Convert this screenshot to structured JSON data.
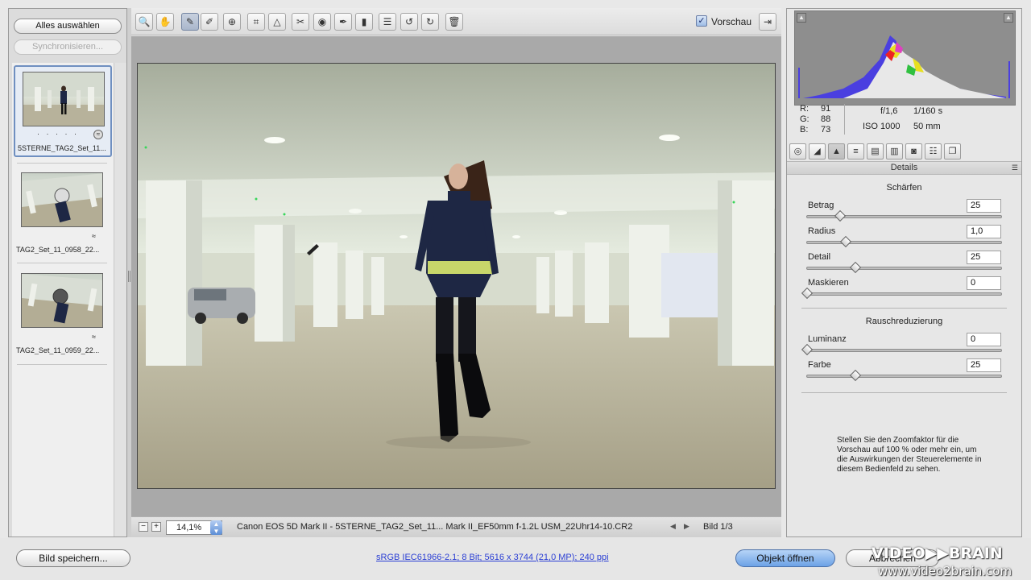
{
  "left_panel": {
    "select_all_label": "Alles auswählen",
    "sync_label": "Synchronisieren...",
    "thumbnails": [
      {
        "caption": "5STERNE_TAG2_Set_11...",
        "rating": "· · · · ·",
        "selected": true
      },
      {
        "caption": "TAG2_Set_11_0958_22...",
        "selected": false
      },
      {
        "caption": "TAG2_Set_11_0959_22...",
        "selected": false
      }
    ]
  },
  "toolbar": {
    "tools": [
      {
        "name": "zoom-tool-icon",
        "glyph": "🔍"
      },
      {
        "name": "hand-tool-icon",
        "glyph": "✋"
      },
      {
        "name": "white-balance-tool-icon",
        "glyph": "✎"
      },
      {
        "name": "color-sampler-tool-icon",
        "glyph": "✐"
      },
      {
        "name": "targeted-adjustment-tool-icon",
        "glyph": "⊕"
      },
      {
        "name": "crop-tool-icon",
        "glyph": "⌗"
      },
      {
        "name": "straighten-tool-icon",
        "glyph": "△"
      },
      {
        "name": "spot-removal-tool-icon",
        "glyph": "✂"
      },
      {
        "name": "red-eye-tool-icon",
        "glyph": "◉"
      },
      {
        "name": "adjustment-brush-icon",
        "glyph": "✒"
      },
      {
        "name": "graduated-filter-icon",
        "glyph": "▮"
      },
      {
        "name": "preferences-icon",
        "glyph": "☰"
      },
      {
        "name": "rotate-left-icon",
        "glyph": "↺"
      },
      {
        "name": "rotate-right-icon",
        "glyph": "↻"
      },
      {
        "name": "trash-icon",
        "glyph": "🗑"
      }
    ],
    "preview_label": "Vorschau",
    "preview_checked": true,
    "fullscreen_glyph": "⇥"
  },
  "status": {
    "zoom_value": "14,1%",
    "file_info": "Canon EOS 5D Mark II - 5STERNE_TAG2_Set_11... Mark II_EF50mm f-1.2L USM_22Uhr14-10.CR2",
    "image_counter": "Bild 1/3"
  },
  "readouts": {
    "r_label": "R:",
    "r_value": "91",
    "g_label": "G:",
    "g_value": "88",
    "b_label": "B:",
    "b_value": "73",
    "aperture": "f/1,6",
    "shutter": "1/160 s",
    "iso": "ISO 1000",
    "focal": "50 mm"
  },
  "panel": {
    "tabs": [
      "◎",
      "◢",
      "▲",
      "≡",
      "▤",
      "▥",
      "◙",
      "☷",
      "❐"
    ],
    "active_tab": 2,
    "title": "Details",
    "sharpen_title": "Schärfen",
    "noise_title": "Rauschreduzierung",
    "sliders": [
      {
        "label": "Betrag",
        "value": "25",
        "pos": 0.17
      },
      {
        "label": "Radius",
        "value": "1,0",
        "pos": 0.2
      },
      {
        "label": "Detail",
        "value": "25",
        "pos": 0.25
      },
      {
        "label": "Maskieren",
        "value": "0",
        "pos": 0.0
      },
      {
        "label": "Luminanz",
        "value": "0",
        "pos": 0.0
      },
      {
        "label": "Farbe",
        "value": "25",
        "pos": 0.25
      }
    ],
    "info": "Stellen Sie den Zoomfaktor für die Vorschau auf 100 % oder mehr ein, um die Auswirkungen der Steuerelemente in diesem Bedienfeld zu sehen."
  },
  "bottom": {
    "save_label": "Bild speichern...",
    "workflow_link": "sRGB IEC61966-2.1; 8 Bit; 5616 x 3744 (21,0 MP); 240 ppi",
    "open_label": "Objekt öffnen",
    "cancel_label": "Abbrechen",
    "watermark": "VIDEO▶▶BRAIN",
    "watermark_url": "www.video2brain.com"
  },
  "colors": {
    "accent_blue": "#6ca2e6",
    "link_blue": "#2b3fd4",
    "selection_border": "#6f8fc0"
  }
}
